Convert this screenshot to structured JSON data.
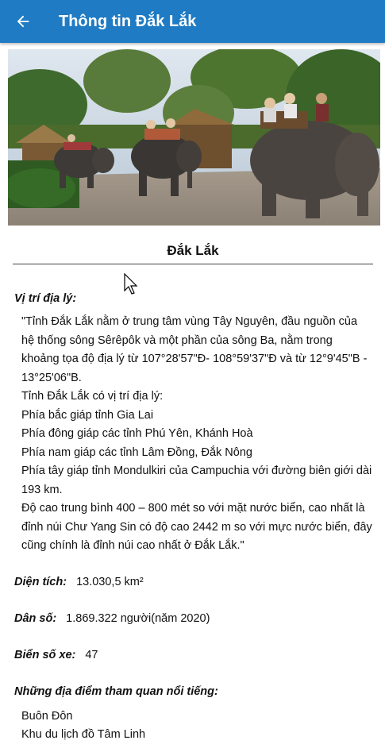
{
  "app_bar": {
    "title": "Thông tin Đắk Lắk",
    "back_icon": "arrow-left-icon",
    "color": "#1e7bc4"
  },
  "hero": {
    "description": "Elephant ride photo",
    "icon": "elephant-photo"
  },
  "place": {
    "name": "Đắk Lắk"
  },
  "geography": {
    "label": "Vị trí địa lý:",
    "lines": [
      "\"Tỉnh Đắk Lắk nằm ở trung tâm vùng Tây Nguyên, đầu nguồn của hệ thống sông Sêrêpôk và một phần của sông Ba, nằm trong khoảng tọa độ địa lý từ 107°28'57\"Đ- 108°59'37\"Đ và từ 12°9'45\"B - 13°25'06\"B.",
      "Tỉnh Đắk Lắk có vị trí địa lý:",
      "Phía bắc giáp tỉnh Gia Lai",
      "Phía đông giáp các tỉnh Phú Yên, Khánh Hoà",
      "Phía nam giáp các tỉnh Lâm Đồng, Đắk Nông",
      "Phía tây giáp tỉnh Mondulkiri của Campuchia với đường biên giới dài 193 km.",
      "Độ cao trung bình 400 – 800 mét so với mặt nước biển, cao nhất là đỉnh núi Chư Yang Sin có độ cao 2442 m so với mực nước biển, đây cũng chính là đỉnh núi cao nhất ở Đắk Lắk.\""
    ]
  },
  "area": {
    "label": "Diện tích:",
    "value": "13.030,5 km²"
  },
  "population": {
    "label": "Dân số:",
    "value": "1.869.322 người(năm 2020)"
  },
  "plate": {
    "label": "Biển số xe:",
    "value": "47"
  },
  "famous_places": {
    "label": "Những địa điểm tham quan nổi tiếng:",
    "items": [
      "Buôn Đôn",
      "Khu du lịch đồ Tâm Linh"
    ]
  }
}
